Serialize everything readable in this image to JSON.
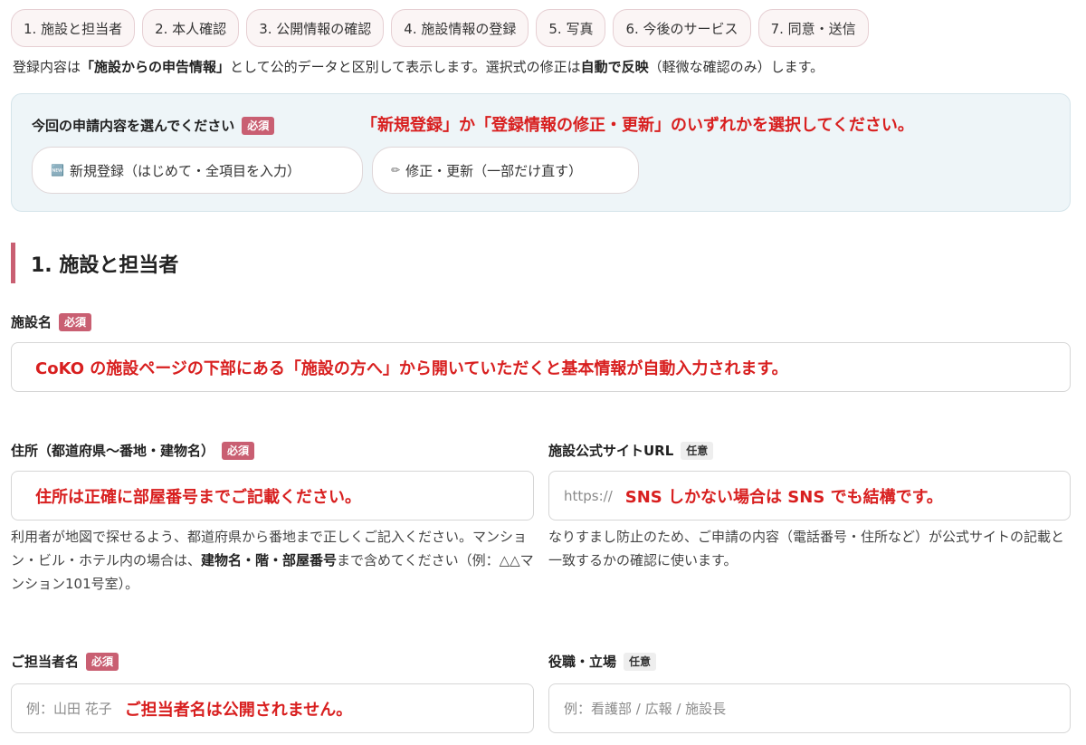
{
  "steps": [
    "1. 施設と担当者",
    "2. 本人確認",
    "3. 公開情報の確認",
    "4. 施設情報の登録",
    "5. 写真",
    "6. 今後のサービス",
    "7. 同意・送信"
  ],
  "intro": {
    "t1": "登録内容は",
    "b1": "「施設からの申告情報」",
    "t2": "として公的データと区別して表示します。選択式の修正は",
    "b2": "自動で反映",
    "t3": "（軽微な確認のみ）します。"
  },
  "request": {
    "label": "今回の申請内容を選んでください",
    "badge": "必須",
    "note": "「新規登録」か「登録情報の修正・更新」のいずれかを選択してください。",
    "options": [
      {
        "icon": "🆕",
        "label": "新規登録（はじめて・全項目を入力）"
      },
      {
        "icon": "✏",
        "label": "修正・更新（一部だけ直す）"
      }
    ]
  },
  "section1": {
    "title": "1. 施設と担当者"
  },
  "facility_name": {
    "label": "施設名",
    "badge": "必須",
    "note": "CoKO の施設ページの下部にある「施設の方へ」から開いていただくと基本情報が自動入力されます。"
  },
  "address": {
    "label": "住所（都道府県〜番地・建物名）",
    "badge": "必須",
    "note": "住所は正確に部屋番号までご記載ください。",
    "help1": "利用者が地図で探せるよう、都道府県から番地まで正しくご記入ください。マンション・ビル・ホテル内の場合は、",
    "help_b": "建物名・階・部屋番号",
    "help2": "まで含めてください（例：△△マンション101号室）。"
  },
  "website": {
    "label": "施設公式サイトURL",
    "badge": "任意",
    "placeholder": "https://",
    "note": "SNS しかない場合は SNS でも結構です。",
    "help": "なりすまし防止のため、ご申請の内容（電話番号・住所など）が公式サイトの記載と一致するかの確認に使います。"
  },
  "contact_name": {
    "label": "ご担当者名",
    "badge": "必須",
    "placeholder": "例：山田 花子",
    "note": "ご担当者名は公開されません。"
  },
  "role": {
    "label": "役職・立場",
    "badge": "任意",
    "placeholder": "例：看護部 / 広報 / 施設長"
  }
}
